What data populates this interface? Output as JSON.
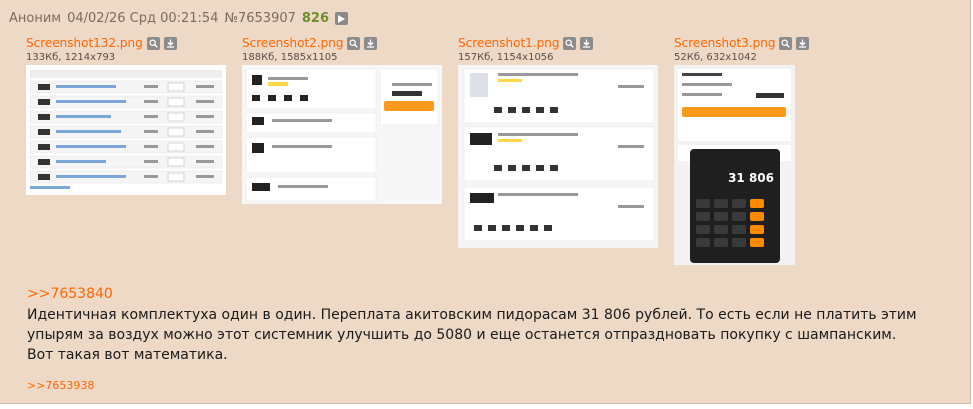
{
  "post": {
    "author": "Аноним",
    "date": "04/02/26 Срд 00:21:54",
    "number": "№7653907",
    "count": "826"
  },
  "files": [
    {
      "name": "Screenshot132.png",
      "meta": "133Кб, 1214x793"
    },
    {
      "name": "Screenshot2.png",
      "meta": "188Кб, 1585x1105"
    },
    {
      "name": "Screenshot1.png",
      "meta": "157Кб, 1154x1056"
    },
    {
      "name": "Screenshot3.png",
      "meta": "52Кб, 632x1042"
    }
  ],
  "calculator_display": "31 806",
  "reply": {
    "link": ">>7653840",
    "lines": [
      "Идентичная комплектуха один в один. Переплата акитовским пидорасам 31 806 рублей. То есть если не платить этим упырям за воздух можно этот системник улучшить до 5080 и еще останется отпраздновать покупку с шампанским.",
      "Вот такая вот математика."
    ]
  },
  "backlink": ">>7653938",
  "colors": {
    "post_bg": "#eed8c6",
    "link": "#ff6600",
    "count": "#6f8f2a",
    "header_text": "#7f6a60"
  },
  "icons": [
    "play-icon",
    "search-icon",
    "download-icon"
  ]
}
